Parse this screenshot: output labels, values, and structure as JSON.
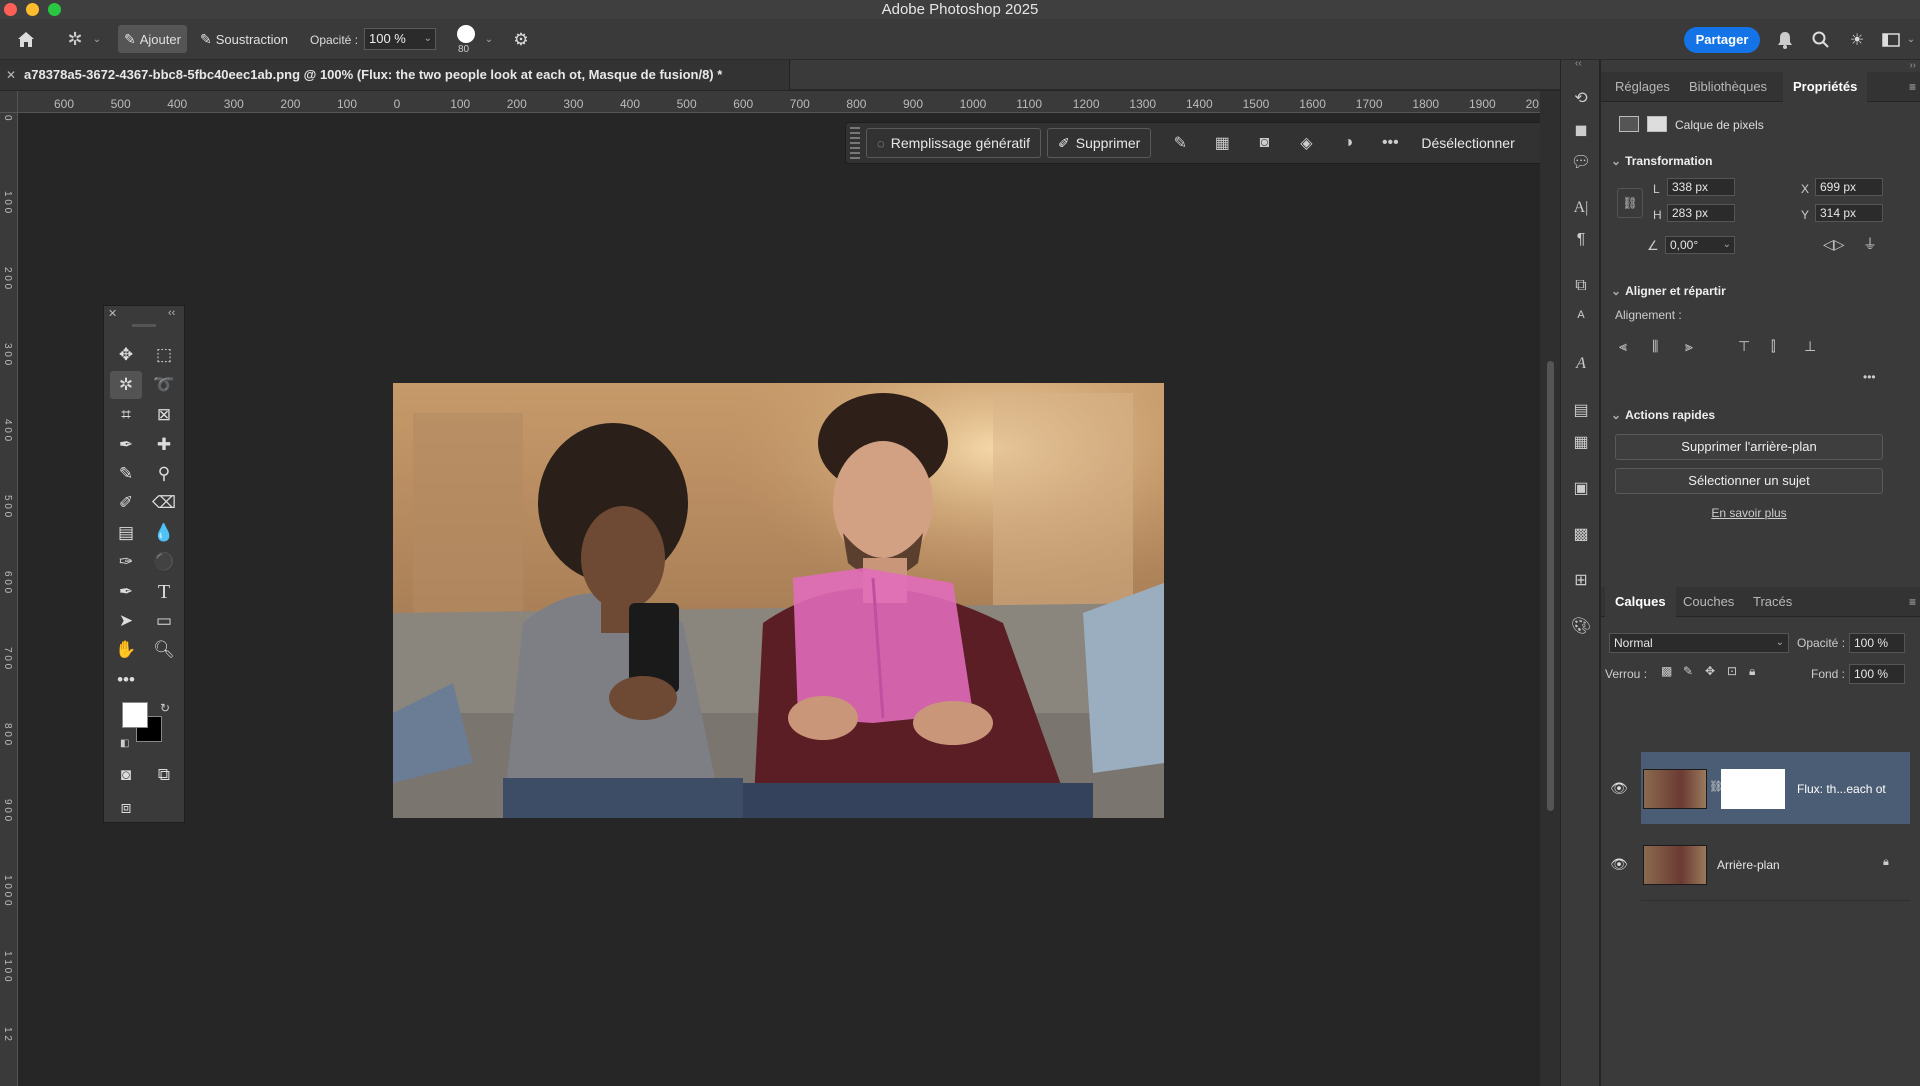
{
  "app": {
    "title": "Adobe Photoshop 2025"
  },
  "options_bar": {
    "add_label": "Ajouter",
    "subtract_label": "Soustraction",
    "opacity_label": "Opacité :",
    "opacity_value": "100 %",
    "brush_size": "80",
    "share_label": "Partager"
  },
  "document": {
    "tab_title": "a78378a5-3672-4367-bbc8-5fbc40eec1ab.png @ 100% (Flux: the two people look at each ot, Masque de fusion/8) *"
  },
  "ruler": {
    "h_ticks": [
      "600",
      "500",
      "400",
      "300",
      "200",
      "100",
      "0",
      "100",
      "200",
      "300",
      "400",
      "500",
      "600",
      "700",
      "800",
      "900",
      "1000",
      "1100",
      "1200",
      "1300",
      "1400",
      "1500",
      "1600",
      "1700",
      "1800",
      "1900",
      "20"
    ],
    "v_ticks": [
      "0",
      "1 0 0",
      "2 0 0",
      "3 0 0",
      "4 0 0",
      "5 0 0",
      "6 0 0",
      "7 0 0",
      "8 0 0",
      "9 0 0",
      "1 0 0 0",
      "1 1 0 0",
      "1 2"
    ]
  },
  "context_bar": {
    "generative_fill": "Remplissage génératif",
    "remove": "Supprimer",
    "deselect": "Désélectionner"
  },
  "properties_panel": {
    "tabs": [
      "Réglages",
      "Bibliothèques",
      "Propriétés"
    ],
    "layer_kind": "Calque de pixels",
    "transform_title": "Transformation",
    "w_label": "L",
    "w_value": "338 px",
    "h_label": "H",
    "h_value": "283 px",
    "x_label": "X",
    "x_value": "699 px",
    "y_label": "Y",
    "y_value": "314 px",
    "angle_value": "0,00°",
    "align_title": "Aligner et répartir",
    "alignment_label": "Alignement :",
    "quick_actions_title": "Actions rapides",
    "remove_bg": "Supprimer l'arrière-plan",
    "select_subject": "Sélectionner un sujet",
    "learn_more": "En savoir plus"
  },
  "layers_panel": {
    "tabs": [
      "Calques",
      "Couches",
      "Tracés"
    ],
    "blend_mode": "Normal",
    "opacity_label": "Opacité :",
    "opacity_value": "100 %",
    "lock_label": "Verrou :",
    "fill_label": "Fond :",
    "fill_value": "100 %",
    "layers": [
      {
        "name": "Flux: th...each ot",
        "selected": true
      },
      {
        "name": "Arrière-plan",
        "selected": false,
        "locked": true
      }
    ]
  },
  "colors": {
    "accent": "#1473e6",
    "selected_layer": "#4b5d74",
    "mask_overlay": "#e26cbd"
  }
}
